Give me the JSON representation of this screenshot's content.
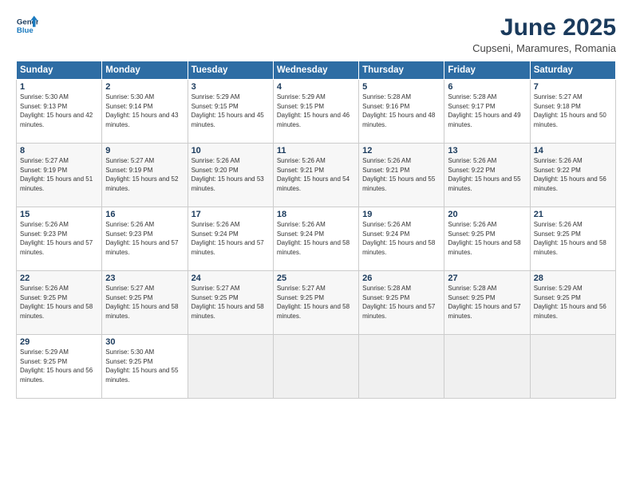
{
  "logo": {
    "line1": "General",
    "line2": "Blue"
  },
  "title": "June 2025",
  "subtitle": "Cupseni, Maramures, Romania",
  "headers": [
    "Sunday",
    "Monday",
    "Tuesday",
    "Wednesday",
    "Thursday",
    "Friday",
    "Saturday"
  ],
  "weeks": [
    [
      {
        "num": "1",
        "rise": "5:30 AM",
        "set": "9:13 PM",
        "daylight": "15 hours and 42 minutes."
      },
      {
        "num": "2",
        "rise": "5:30 AM",
        "set": "9:14 PM",
        "daylight": "15 hours and 43 minutes."
      },
      {
        "num": "3",
        "rise": "5:29 AM",
        "set": "9:15 PM",
        "daylight": "15 hours and 45 minutes."
      },
      {
        "num": "4",
        "rise": "5:29 AM",
        "set": "9:15 PM",
        "daylight": "15 hours and 46 minutes."
      },
      {
        "num": "5",
        "rise": "5:28 AM",
        "set": "9:16 PM",
        "daylight": "15 hours and 48 minutes."
      },
      {
        "num": "6",
        "rise": "5:28 AM",
        "set": "9:17 PM",
        "daylight": "15 hours and 49 minutes."
      },
      {
        "num": "7",
        "rise": "5:27 AM",
        "set": "9:18 PM",
        "daylight": "15 hours and 50 minutes."
      }
    ],
    [
      {
        "num": "8",
        "rise": "5:27 AM",
        "set": "9:19 PM",
        "daylight": "15 hours and 51 minutes."
      },
      {
        "num": "9",
        "rise": "5:27 AM",
        "set": "9:19 PM",
        "daylight": "15 hours and 52 minutes."
      },
      {
        "num": "10",
        "rise": "5:26 AM",
        "set": "9:20 PM",
        "daylight": "15 hours and 53 minutes."
      },
      {
        "num": "11",
        "rise": "5:26 AM",
        "set": "9:21 PM",
        "daylight": "15 hours and 54 minutes."
      },
      {
        "num": "12",
        "rise": "5:26 AM",
        "set": "9:21 PM",
        "daylight": "15 hours and 55 minutes."
      },
      {
        "num": "13",
        "rise": "5:26 AM",
        "set": "9:22 PM",
        "daylight": "15 hours and 55 minutes."
      },
      {
        "num": "14",
        "rise": "5:26 AM",
        "set": "9:22 PM",
        "daylight": "15 hours and 56 minutes."
      }
    ],
    [
      {
        "num": "15",
        "rise": "5:26 AM",
        "set": "9:23 PM",
        "daylight": "15 hours and 57 minutes."
      },
      {
        "num": "16",
        "rise": "5:26 AM",
        "set": "9:23 PM",
        "daylight": "15 hours and 57 minutes."
      },
      {
        "num": "17",
        "rise": "5:26 AM",
        "set": "9:24 PM",
        "daylight": "15 hours and 57 minutes."
      },
      {
        "num": "18",
        "rise": "5:26 AM",
        "set": "9:24 PM",
        "daylight": "15 hours and 58 minutes."
      },
      {
        "num": "19",
        "rise": "5:26 AM",
        "set": "9:24 PM",
        "daylight": "15 hours and 58 minutes."
      },
      {
        "num": "20",
        "rise": "5:26 AM",
        "set": "9:25 PM",
        "daylight": "15 hours and 58 minutes."
      },
      {
        "num": "21",
        "rise": "5:26 AM",
        "set": "9:25 PM",
        "daylight": "15 hours and 58 minutes."
      }
    ],
    [
      {
        "num": "22",
        "rise": "5:26 AM",
        "set": "9:25 PM",
        "daylight": "15 hours and 58 minutes."
      },
      {
        "num": "23",
        "rise": "5:27 AM",
        "set": "9:25 PM",
        "daylight": "15 hours and 58 minutes."
      },
      {
        "num": "24",
        "rise": "5:27 AM",
        "set": "9:25 PM",
        "daylight": "15 hours and 58 minutes."
      },
      {
        "num": "25",
        "rise": "5:27 AM",
        "set": "9:25 PM",
        "daylight": "15 hours and 58 minutes."
      },
      {
        "num": "26",
        "rise": "5:28 AM",
        "set": "9:25 PM",
        "daylight": "15 hours and 57 minutes."
      },
      {
        "num": "27",
        "rise": "5:28 AM",
        "set": "9:25 PM",
        "daylight": "15 hours and 57 minutes."
      },
      {
        "num": "28",
        "rise": "5:29 AM",
        "set": "9:25 PM",
        "daylight": "15 hours and 56 minutes."
      }
    ],
    [
      {
        "num": "29",
        "rise": "5:29 AM",
        "set": "9:25 PM",
        "daylight": "15 hours and 56 minutes."
      },
      {
        "num": "30",
        "rise": "5:30 AM",
        "set": "9:25 PM",
        "daylight": "15 hours and 55 minutes."
      },
      null,
      null,
      null,
      null,
      null
    ]
  ]
}
